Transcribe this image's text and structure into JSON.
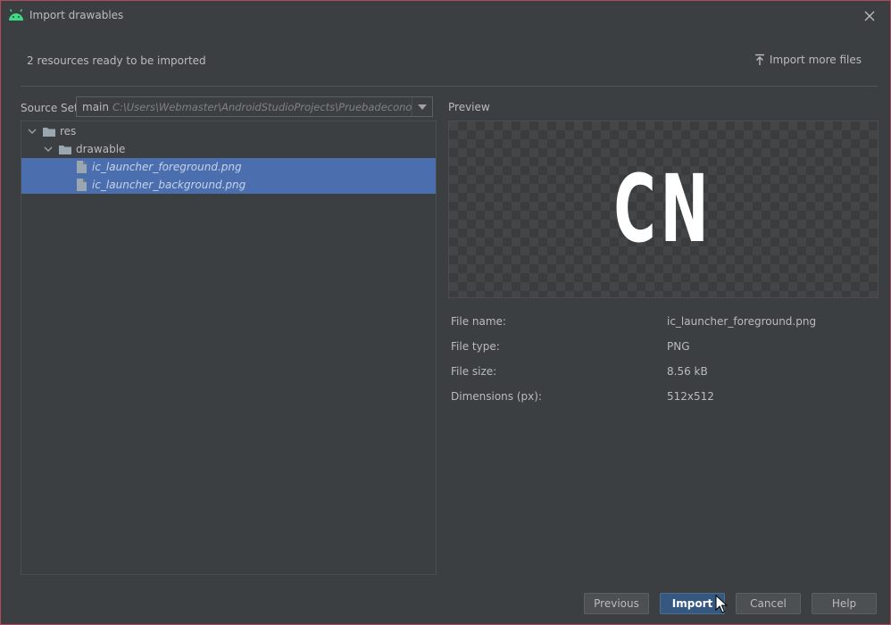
{
  "window": {
    "title": "Import drawables"
  },
  "header": {
    "ready_text": "2 resources ready to be imported",
    "import_more_label": "Import more files"
  },
  "source_set": {
    "label": "Source Set:",
    "selected_name": "main",
    "selected_path": "C:\\Users\\Webmaster\\AndroidStudioProjects\\Pruebadeconos\\app\\"
  },
  "tree": {
    "root": "res",
    "folder": "drawable",
    "files": [
      "ic_launcher_foreground.png",
      "ic_launcher_background.png"
    ]
  },
  "preview": {
    "label": "Preview",
    "image_text": "CN"
  },
  "info": {
    "file_name_label": "File name:",
    "file_name_value": "ic_launcher_foreground.png",
    "file_type_label": "File type:",
    "file_type_value": "PNG",
    "file_size_label": "File size:",
    "file_size_value": "8.56 kB",
    "dimensions_label": "Dimensions (px):",
    "dimensions_value": "512x512"
  },
  "buttons": {
    "previous": "Previous",
    "import": "Import",
    "cancel": "Cancel",
    "help": "Help"
  },
  "colors": {
    "background": "#3c3f41",
    "selection": "#4b6eaf",
    "primary_button": "#365880",
    "android_green": "#3ddc84"
  }
}
